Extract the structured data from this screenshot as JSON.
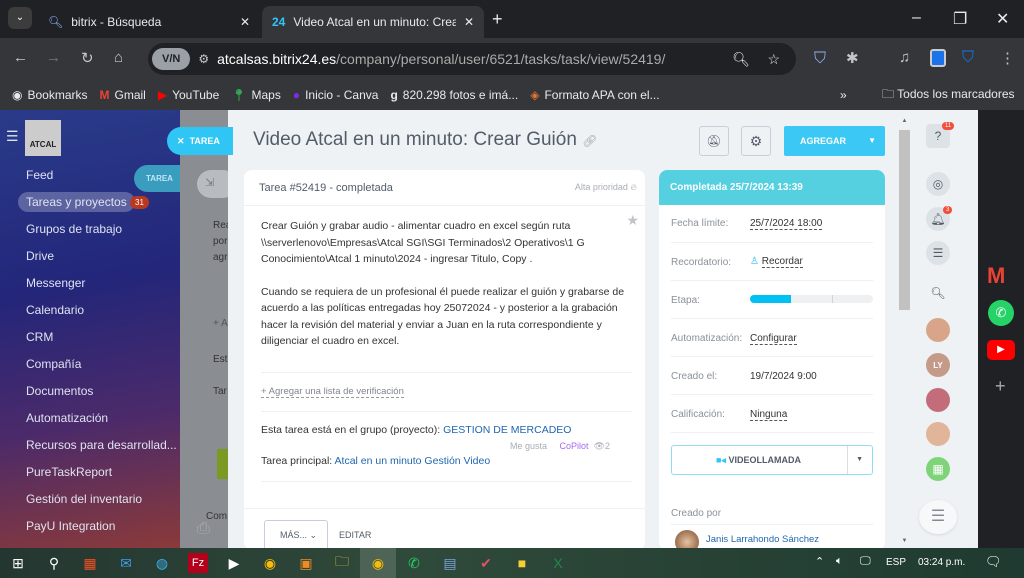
{
  "browser": {
    "tabs": [
      {
        "title": "bitrix - Búsqueda"
      },
      {
        "title": "Video Atcal en un minuto: Crear Guión"
      }
    ],
    "url_host": "atcalsas.bitrix24.es",
    "url_path": "/company/personal/user/6521/tasks/task/view/52419/",
    "vpn_label": "V/N",
    "bookmarks": [
      "Bookmarks",
      "Gmail",
      "YouTube",
      "Maps",
      "Inicio - Canva",
      "820.298 fotos e imá...",
      "Formato APA con el..."
    ],
    "all_bookmarks": "Todos los marcadores"
  },
  "sidebar": {
    "logo": "ATCAL",
    "items": [
      "Feed",
      "Tareas y proyectos",
      "Grupos de trabajo",
      "Drive",
      "Messenger",
      "Calendario",
      "CRM",
      "Compañía",
      "Documentos",
      "Automatización",
      "Recursos para desarrollad...",
      "PureTaskReport",
      "Gestión del inventario",
      "PayU Integration"
    ],
    "tasks_badge": "31",
    "tarea_chip": "TAREA"
  },
  "background": {
    "snippets": [
      "Rea",
      "por",
      "agr",
      "+ A",
      "Est",
      "Tar",
      "Com"
    ]
  },
  "slider": {
    "close_label": "TAREA"
  },
  "task": {
    "title": "Video Atcal en un minuto: Crear Guión",
    "header": "Tarea #52419 - completada",
    "priority": "Alta prioridad",
    "description_p1": "Crear Guión  y grabar audio - alimentar cuadro en excel  según ruta \\\\serverlenovo\\Empresas\\Atcal SGI\\SGI Terminados\\2 Operativos\\1 G Conocimiento\\Atcal 1 minuto\\2024 - ingresar Titulo, Copy .",
    "description_p2": "Cuando se requiera de un profesional él puede realizar el guión y grabarse de acuerdo a las políticas entregadas hoy 25072024 - y posterior a la grabación hacer la revisión del material y enviar a Juan en la ruta correspondiente y diligenciar el cuadro en excel.",
    "checklist_link": "+ Agregar una lista de verificación",
    "group_label": "Esta tarea está en el grupo (proyecto):",
    "group_name": "GESTION DE MERCADEO",
    "like": "Me gusta",
    "copilot": "CoPilot",
    "views": "2",
    "parent_label": "Tarea principal:",
    "parent_name": "Atcal en un minuto Gestión Video",
    "more_button": "MÁS...",
    "edit_button": "EDITAR"
  },
  "toolbar": {
    "add_button": "AGREGAR"
  },
  "details": {
    "status": "Completada 25/7/2024 13:39",
    "status_color": "#55d0e0",
    "rows": [
      {
        "label": "Fecha límite:",
        "value": "25/7/2024 18:00"
      },
      {
        "label": "Recordatorio:",
        "value": "Recordar"
      },
      {
        "label": "Etapa:",
        "value": ""
      },
      {
        "label": "Automatización:",
        "value": "Configurar"
      },
      {
        "label": "Creado el:",
        "value": "19/7/2024 9:00"
      },
      {
        "label": "Calificación:",
        "value": "Ninguna"
      }
    ],
    "stage_progress_fraction": 0.33,
    "video_call": "VIDEOLLAMADA",
    "created_by_label": "Creado por",
    "creator": "Janis Larrahondo Sánchez"
  },
  "right_panel": {
    "help_badge": "11",
    "notif_badge": "3",
    "avatar_initials": "LY"
  },
  "taskbar": {
    "language": "ESP",
    "time": "03:24 p.m."
  }
}
